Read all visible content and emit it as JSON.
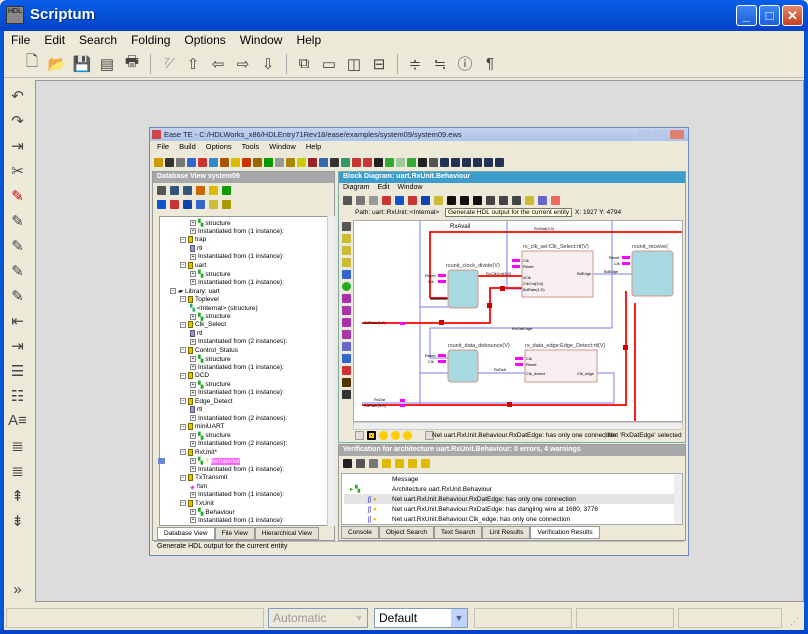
{
  "app": {
    "title": "Scriptum",
    "icon": "hdl-logo-icon"
  },
  "menu": [
    "File",
    "Edit",
    "Search",
    "Folding",
    "Options",
    "Window",
    "Help"
  ],
  "toolbar": [
    "new-file-icon",
    "open-folder-icon",
    "save-icon",
    "save-all-icon",
    "print-icon",
    "comment-icon",
    "move-up-icon",
    "move-left-icon",
    "move-right-icon",
    "move-down-icon",
    "cascade-windows-icon",
    "tile-windows-icon",
    "tile-vertical-icon",
    "tile-horizontal-icon",
    "indent-icon",
    "outdent-icon",
    "info-icon",
    "pilcrow-icon"
  ],
  "left_toolbar": [
    "undo-icon",
    "redo-icon",
    "jump-icon",
    "cut-icon",
    "marker-icon",
    "marker-next-icon",
    "marker-prev-icon",
    "marker-clear-icon",
    "marker-list-icon",
    "indent-left-icon",
    "indent-right-icon",
    "list-icon",
    "list-numbered-icon",
    "font-size-icon",
    "align-icon",
    "align-justify-icon",
    "collapse-icon",
    "expand-icon",
    "more-icon"
  ],
  "statusbar": {
    "mode": "Automatic",
    "style": "Default"
  },
  "inner": {
    "title": "Ease TE - C:/HDLWorks_x86/HDLEntry71Rev18/ease/examples/system09/system09.ews",
    "menu": [
      "File",
      "Build",
      "Options",
      "Tools",
      "Window",
      "Help"
    ],
    "db_view": {
      "title": "Database View system09",
      "tree": [
        {
          "level": 2,
          "text": "structure",
          "kind": "struct"
        },
        {
          "level": 2,
          "text": "Instantiated from (1 instance):",
          "kind": "inst"
        },
        {
          "level": 1,
          "text": "trap",
          "kind": "entity"
        },
        {
          "level": 2,
          "text": "rtl",
          "kind": "arch"
        },
        {
          "level": 2,
          "text": "Instantiated from (1 instance):",
          "kind": "inst"
        },
        {
          "level": 1,
          "text": "uart",
          "kind": "entity"
        },
        {
          "level": 2,
          "text": "structure",
          "kind": "struct"
        },
        {
          "level": 2,
          "text": "Instantiated from (1 instance):",
          "kind": "inst"
        },
        {
          "level": 0,
          "text": "Library: uart",
          "kind": "lib"
        },
        {
          "level": 1,
          "text": "Toplevel",
          "kind": "entity"
        },
        {
          "level": 2,
          "text": "<Internal> (structure)",
          "kind": "internal"
        },
        {
          "level": 2,
          "text": "structure",
          "kind": "struct"
        },
        {
          "level": 1,
          "text": "Clk_Select",
          "kind": "entity"
        },
        {
          "level": 2,
          "text": "rtl",
          "kind": "arch"
        },
        {
          "level": 2,
          "text": "Instantiated from (2 instances):",
          "kind": "inst"
        },
        {
          "level": 1,
          "text": "Control_Status",
          "kind": "entity"
        },
        {
          "level": 2,
          "text": "structure",
          "kind": "struct"
        },
        {
          "level": 2,
          "text": "Instantiated from (1 instance):",
          "kind": "inst"
        },
        {
          "level": 1,
          "text": "DCD",
          "kind": "entity"
        },
        {
          "level": 2,
          "text": "structure",
          "kind": "struct"
        },
        {
          "level": 2,
          "text": "Instantiated from (1 instance):",
          "kind": "inst"
        },
        {
          "level": 1,
          "text": "Edge_Detect",
          "kind": "entity"
        },
        {
          "level": 2,
          "text": "rtl",
          "kind": "arch"
        },
        {
          "level": 2,
          "text": "Instantiated from (2 instances):",
          "kind": "inst"
        },
        {
          "level": 1,
          "text": "miniUART",
          "kind": "entity"
        },
        {
          "level": 2,
          "text": "structure",
          "kind": "struct"
        },
        {
          "level": 2,
          "text": "Instantiated from (2 instances):",
          "kind": "inst"
        },
        {
          "level": 1,
          "text": "RxUnit*",
          "kind": "entity"
        },
        {
          "level": 2,
          "text": "Behaviour",
          "kind": "selected"
        },
        {
          "level": 2,
          "text": "Instantiated from (1 instance):",
          "kind": "inst"
        },
        {
          "level": 1,
          "text": "TxTransmit",
          "kind": "entity"
        },
        {
          "level": 2,
          "text": "fsm",
          "kind": "fsm"
        },
        {
          "level": 2,
          "text": "Instantiated from (1 instance):",
          "kind": "inst"
        },
        {
          "level": 1,
          "text": "TxUnit",
          "kind": "entity"
        },
        {
          "level": 2,
          "text": "Behaviour",
          "kind": "struct"
        },
        {
          "level": 2,
          "text": "Instantiated from (1 instance):",
          "kind": "inst"
        }
      ],
      "tabs": [
        "Database View",
        "File View",
        "Hierarchical View"
      ]
    },
    "block_diagram": {
      "title": "Block Diagram: uart.RxUnit.Behaviour",
      "menu": [
        "Diagram",
        "Edit",
        "Window"
      ],
      "path": "Path: uart::RxUnit::<Internal>",
      "tooltip": "Generate HDL output for the current entity",
      "coords": "X: 1927 Y: 4794",
      "blocks": [
        {
          "name": "rxunit_clock_divide(V)",
          "ports": [
            "Reset",
            "Clk"
          ]
        },
        {
          "name": "rx_clk_sel:Clk_Select:rtl(V)",
          "ports": [
            "Clk",
            "Reset",
            "sClk",
            "ClkCnt(3:0)",
            "BdRate(1:0)",
            "BdEdge"
          ]
        },
        {
          "name": "rxunit_receive(",
          "ports": [
            "Reset",
            "Clk"
          ]
        },
        {
          "name": "rxunit_data_debounce(V)",
          "ports": [
            "Reset",
            "Clk"
          ]
        },
        {
          "name": "rx_data_edge:Edge_Detect:rtl(V)",
          "ports": [
            "Clk",
            "Reset",
            "Clk_detect",
            "Clk_edge"
          ]
        }
      ],
      "nets": [
        "RxAvail",
        "RxStat(3:0)",
        "RxClkCnt(3:0)",
        "BdEdge",
        "BdRate(1:0)",
        "RxDatEdge",
        "RxDeb",
        "RxDat",
        "RdRate(3:0)"
      ],
      "status_message": "Net uart.RxUnit.Behaviour.RxDatEdge: has only one connection",
      "status_selection": "Net 'RxDatEdge' selected"
    },
    "verification": {
      "title": "Verification for architecture uart.RxUnit.Behaviour: 0 errors, 4 warnings",
      "column": "Message",
      "rows": [
        "Architecture uart.RxUnit.Behaviour",
        "Net uart.RxUnit.Behaviour.RxDatEdge: has only one connection",
        "Net uart.RxUnit.Behaviour.RxDatEdge: has dangling wire at 1680, 3776",
        "Net uart.RxUnit.Behaviour.Clk_edge: has only one connection"
      ],
      "tabs": [
        "Console",
        "Object Search",
        "Text Search",
        "Lint Results",
        "Verification Results"
      ]
    },
    "status": "Generate HDL output for the current entity"
  },
  "colors": {
    "title_blue": "#0454d8",
    "wire_red": "#ff0000",
    "wire_blue": "#7b7bf0",
    "block_fill": "#a8d8e0",
    "port_magenta": "#ff00ff",
    "selection_pink": "#ff66ff"
  }
}
